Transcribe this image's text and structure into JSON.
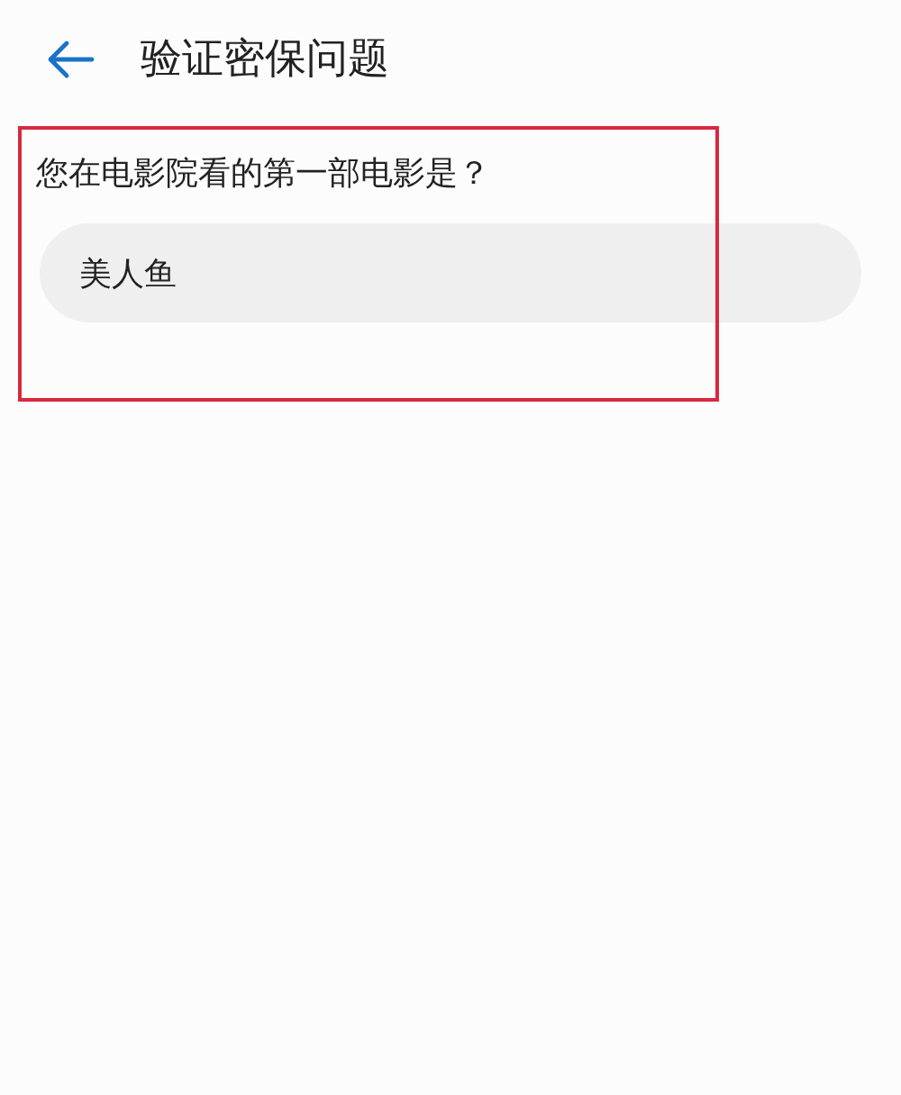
{
  "header": {
    "title": "验证密保问题"
  },
  "security_question": {
    "question": "您在电影院看的第一部电影是？",
    "answer": {
      "value": "美人鱼"
    },
    "highlighted": true
  }
}
